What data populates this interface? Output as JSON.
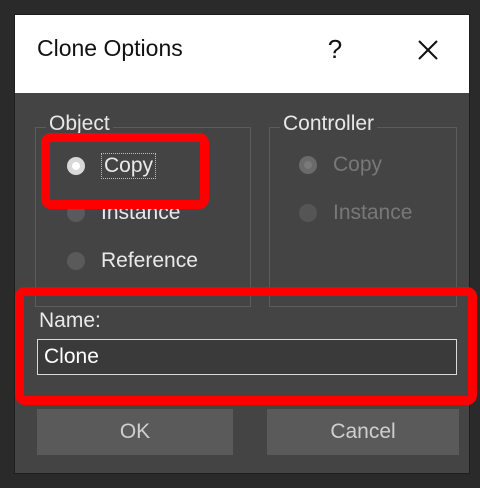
{
  "dialog": {
    "title": "Clone Options",
    "help_label": "?",
    "close_icon": "close-icon"
  },
  "object_group": {
    "label": "Object",
    "options": [
      {
        "label": "Copy",
        "selected": true,
        "enabled": true
      },
      {
        "label": "Instance",
        "selected": false,
        "enabled": true
      },
      {
        "label": "Reference",
        "selected": false,
        "enabled": true
      }
    ]
  },
  "controller_group": {
    "label": "Controller",
    "options": [
      {
        "label": "Copy",
        "selected": true,
        "enabled": false
      },
      {
        "label": "Instance",
        "selected": false,
        "enabled": false
      }
    ]
  },
  "name_field": {
    "label": "Name:",
    "value": "Clone"
  },
  "buttons": {
    "ok": "OK",
    "cancel": "Cancel"
  },
  "colors": {
    "dialog_bg": "#444444",
    "titlebar_bg": "#ffffff",
    "highlight": "#ff0000"
  }
}
